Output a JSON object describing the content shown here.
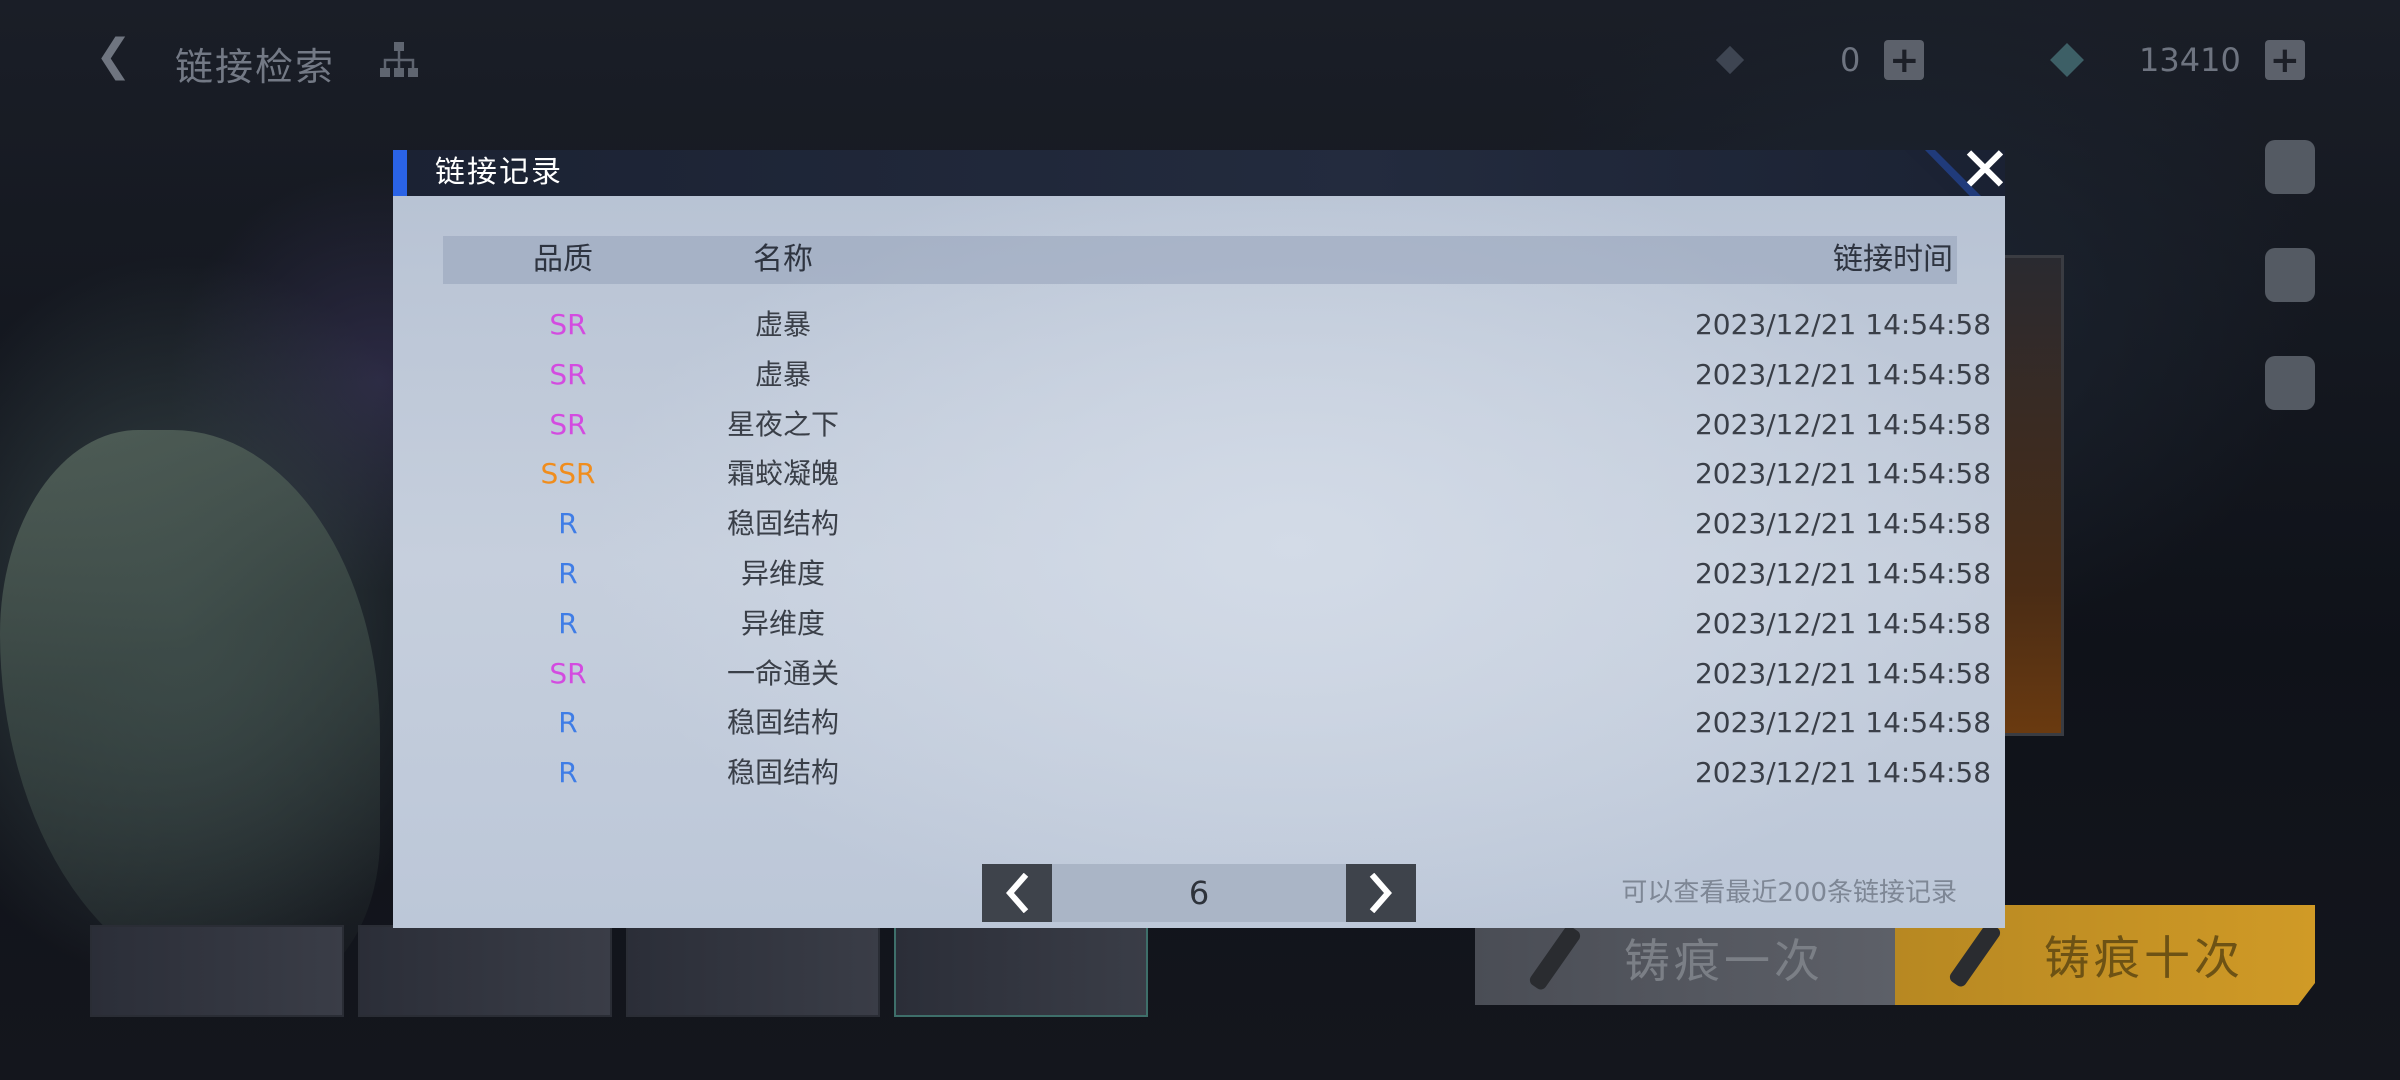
{
  "topbar": {
    "title": "链接检索",
    "resource1": "0",
    "resource2": "13410"
  },
  "modal": {
    "title": "链接记录",
    "columns": {
      "quality": "品质",
      "name": "名称",
      "time": "链接时间"
    },
    "records": [
      {
        "quality": "SR",
        "name": "虚暴",
        "time": "2023/12/21 14:54:58"
      },
      {
        "quality": "SR",
        "name": "虚暴",
        "time": "2023/12/21 14:54:58"
      },
      {
        "quality": "SR",
        "name": "星夜之下",
        "time": "2023/12/21 14:54:58"
      },
      {
        "quality": "SSR",
        "name": "霜蛟凝魄",
        "time": "2023/12/21 14:54:58"
      },
      {
        "quality": "R",
        "name": "稳固结构",
        "time": "2023/12/21 14:54:58"
      },
      {
        "quality": "R",
        "name": "异维度",
        "time": "2023/12/21 14:54:58"
      },
      {
        "quality": "R",
        "name": "异维度",
        "time": "2023/12/21 14:54:58"
      },
      {
        "quality": "SR",
        "name": "一命通关",
        "time": "2023/12/21 14:54:58"
      },
      {
        "quality": "R",
        "name": "稳固结构",
        "time": "2023/12/21 14:54:58"
      },
      {
        "quality": "R",
        "name": "稳固结构",
        "time": "2023/12/21 14:54:58"
      }
    ],
    "page": "6",
    "hint": "可以查看最近200条链接记录"
  },
  "colors": {
    "SR": "#d34be0",
    "SSR": "#f08d1d",
    "R": "#3f7de6",
    "accent": "#2a63e6"
  },
  "bottom": {
    "once_label": "铸痕一次",
    "ten_label": "铸痕十次"
  }
}
